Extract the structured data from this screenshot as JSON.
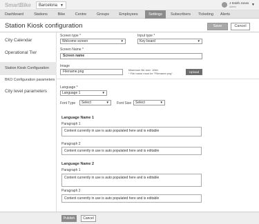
{
  "app": {
    "logo": "SmartBike",
    "city": "Barcelona"
  },
  "user": {
    "name": "J Smith Jones",
    "role": "Admin"
  },
  "nav": {
    "tabs": [
      "Dashboard",
      "Stations",
      "Bike",
      "Centre",
      "Groups",
      "Employees",
      "Settings",
      "Subscribers",
      "Ticketing",
      "Alerts"
    ],
    "active": "Settings"
  },
  "header": {
    "title": "Station Kiosk configuration",
    "save_label": "Save",
    "cancel_label": "Cancel"
  },
  "sidebar": {
    "items": [
      "City Calendar",
      "Operational Tier",
      "Station Kiosk Configuration",
      "BKO Configuration parameters",
      "City level parameters"
    ],
    "active": "Station Kiosk Configuration"
  },
  "form": {
    "screen_type": {
      "label": "Screen type *",
      "value": "Welcome screen"
    },
    "input_type": {
      "label": "Input type *",
      "value": "Key board"
    },
    "screen_name": {
      "label": "Screen Name *",
      "value": "Screen name"
    },
    "image": {
      "label": "Image",
      "value": "Filename.png",
      "note_1": "Maximum file size: 10kb",
      "note_2": "* File name must be \"Filename.png\".",
      "upload_label": "Upload"
    },
    "language": {
      "label": "Language *",
      "value": "Language 1"
    },
    "font_type": {
      "label": "Font Type",
      "value": "Select"
    },
    "font_size": {
      "label": "Font Size",
      "value": "Select"
    },
    "sections": [
      {
        "title": "Language Name 1",
        "p1_label": "Paragraph 1",
        "p1_value": "Content currently in use is auto populated here and is editable",
        "p2_label": "Paragraph 2",
        "p2_value": "Content currently in use is auto populated here and is editable"
      },
      {
        "title": "Language Name 2",
        "p1_label": "Paragraph  1",
        "p1_value": "Content currently in use is auto populated here and is editable",
        "p2_label": "Paragraph 2",
        "p2_value": "Content currently in use is auto populated here and is editable"
      }
    ]
  },
  "footer": {
    "publish_label": "Publish",
    "cancel_label": "Cancel"
  },
  "icons": {
    "caret": "chevron-down-icon",
    "avatar": "user-avatar-icon"
  }
}
